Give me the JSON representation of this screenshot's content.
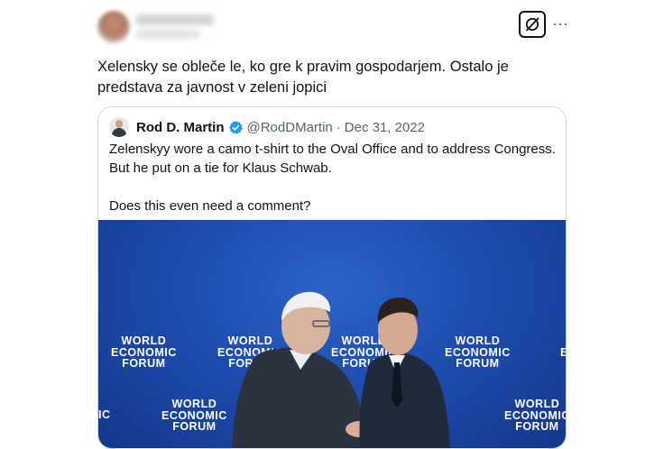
{
  "post": {
    "text": "Xelensky se obleče le, ko gre k pravim gospodarjem. Ostalo je predstava za javnost v zeleni jopici",
    "grok_icon": "grok-icon",
    "more_icon": "more-horizontal-icon",
    "more_label": "···"
  },
  "quote": {
    "author_name": "Rod D. Martin",
    "verified_color": "#1d9bf0",
    "handle": "@RodDMartin",
    "separator": "·",
    "date": "Dec 31, 2022",
    "text_line1": "Zelenskyy wore a camo t-shirt to the Oval Office and to address Congress. But he put on a tie for Klaus Schwab.",
    "text_line2": "Does this even need a comment?"
  },
  "image": {
    "backdrop_color": "#1f4fb3",
    "logo_lines": [
      "WORLD",
      "ECONOMIC",
      "FORUM"
    ],
    "logo_partial_left": "IC",
    "logo_partial_right": "E"
  }
}
